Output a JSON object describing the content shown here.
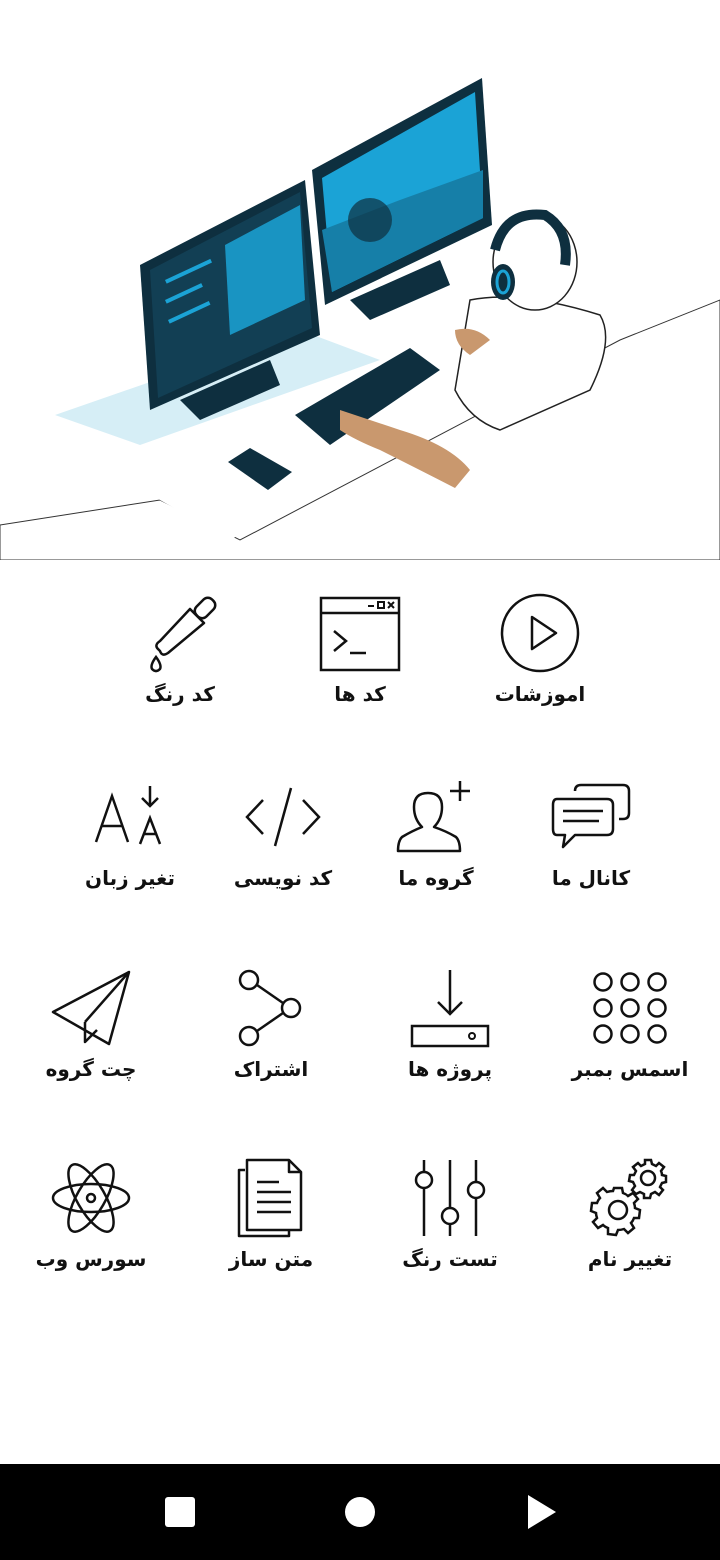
{
  "hero": {
    "illustration": "developer-at-dual-monitors-illustration",
    "colors": {
      "accent": "#1ba3d6",
      "screen": "#0e2f3f",
      "skin": "#c9986e",
      "floor": "#d6eef6"
    }
  },
  "menu": {
    "row1": [
      {
        "label": "اموزشات",
        "icon": "play-circle-icon"
      },
      {
        "label": "کد ها",
        "icon": "terminal-window-icon"
      },
      {
        "label": "کد رنگ",
        "icon": "eyedropper-icon"
      }
    ],
    "row2": [
      {
        "label": "کانال ما",
        "icon": "chat-bubbles-icon"
      },
      {
        "label": "گروه ما",
        "icon": "add-user-icon"
      },
      {
        "label": "کد نویسی",
        "icon": "code-brackets-icon"
      },
      {
        "label": "تغیر زبان",
        "icon": "translate-icon"
      }
    ],
    "row3": [
      {
        "label": "اسمس بمبر",
        "icon": "dots-grid-icon"
      },
      {
        "label": "پروژه ها",
        "icon": "download-tray-icon"
      },
      {
        "label": "اشتراک",
        "icon": "share-icon"
      },
      {
        "label": "چت گروه",
        "icon": "paper-plane-icon"
      }
    ],
    "row4": [
      {
        "label": "تغییر نام",
        "icon": "gears-icon"
      },
      {
        "label": "تست رنگ",
        "icon": "sliders-icon"
      },
      {
        "label": "متن ساز",
        "icon": "document-icon"
      },
      {
        "label": "سورس وب",
        "icon": "atom-icon"
      }
    ]
  },
  "navbar": {
    "buttons": [
      "recents-square-icon",
      "home-circle-icon",
      "back-triangle-icon"
    ]
  }
}
